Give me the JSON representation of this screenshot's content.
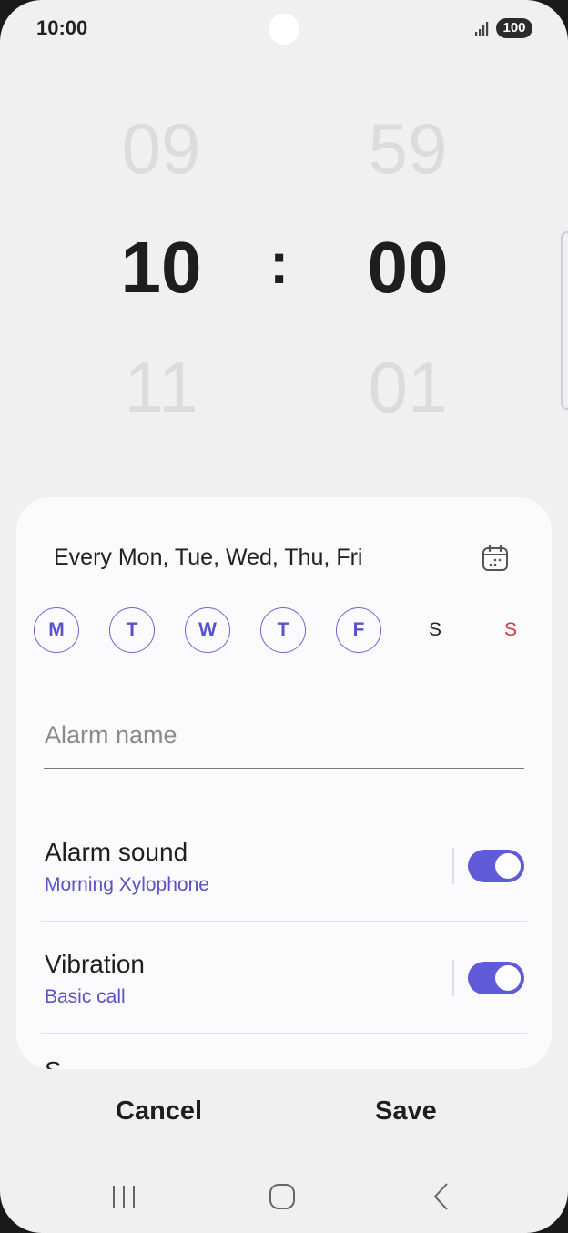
{
  "status_bar": {
    "time": "10:00",
    "battery": "100"
  },
  "picker": {
    "hour_prev": "09",
    "hour": "10",
    "hour_next": "11",
    "minute_prev": "59",
    "minute": "00",
    "minute_next": "01",
    "separator": ":"
  },
  "repeat": {
    "summary": "Every Mon, Tue, Wed, Thu, Fri",
    "days": [
      {
        "label": "M",
        "selected": true
      },
      {
        "label": "T",
        "selected": true
      },
      {
        "label": "W",
        "selected": true
      },
      {
        "label": "T",
        "selected": true
      },
      {
        "label": "F",
        "selected": true
      },
      {
        "label": "S",
        "selected": false
      },
      {
        "label": "S",
        "selected": false
      }
    ]
  },
  "alarm_name": {
    "placeholder": "Alarm name"
  },
  "settings": [
    {
      "title": "Alarm sound",
      "subtitle": "Morning Xylophone",
      "enabled": true
    },
    {
      "title": "Vibration",
      "subtitle": "Basic call",
      "enabled": true
    }
  ],
  "next_row_partial": "S",
  "actions": {
    "cancel": "Cancel",
    "save": "Save"
  },
  "colors": {
    "accent": "#5f5bd8",
    "sunday": "#d03a3a"
  }
}
